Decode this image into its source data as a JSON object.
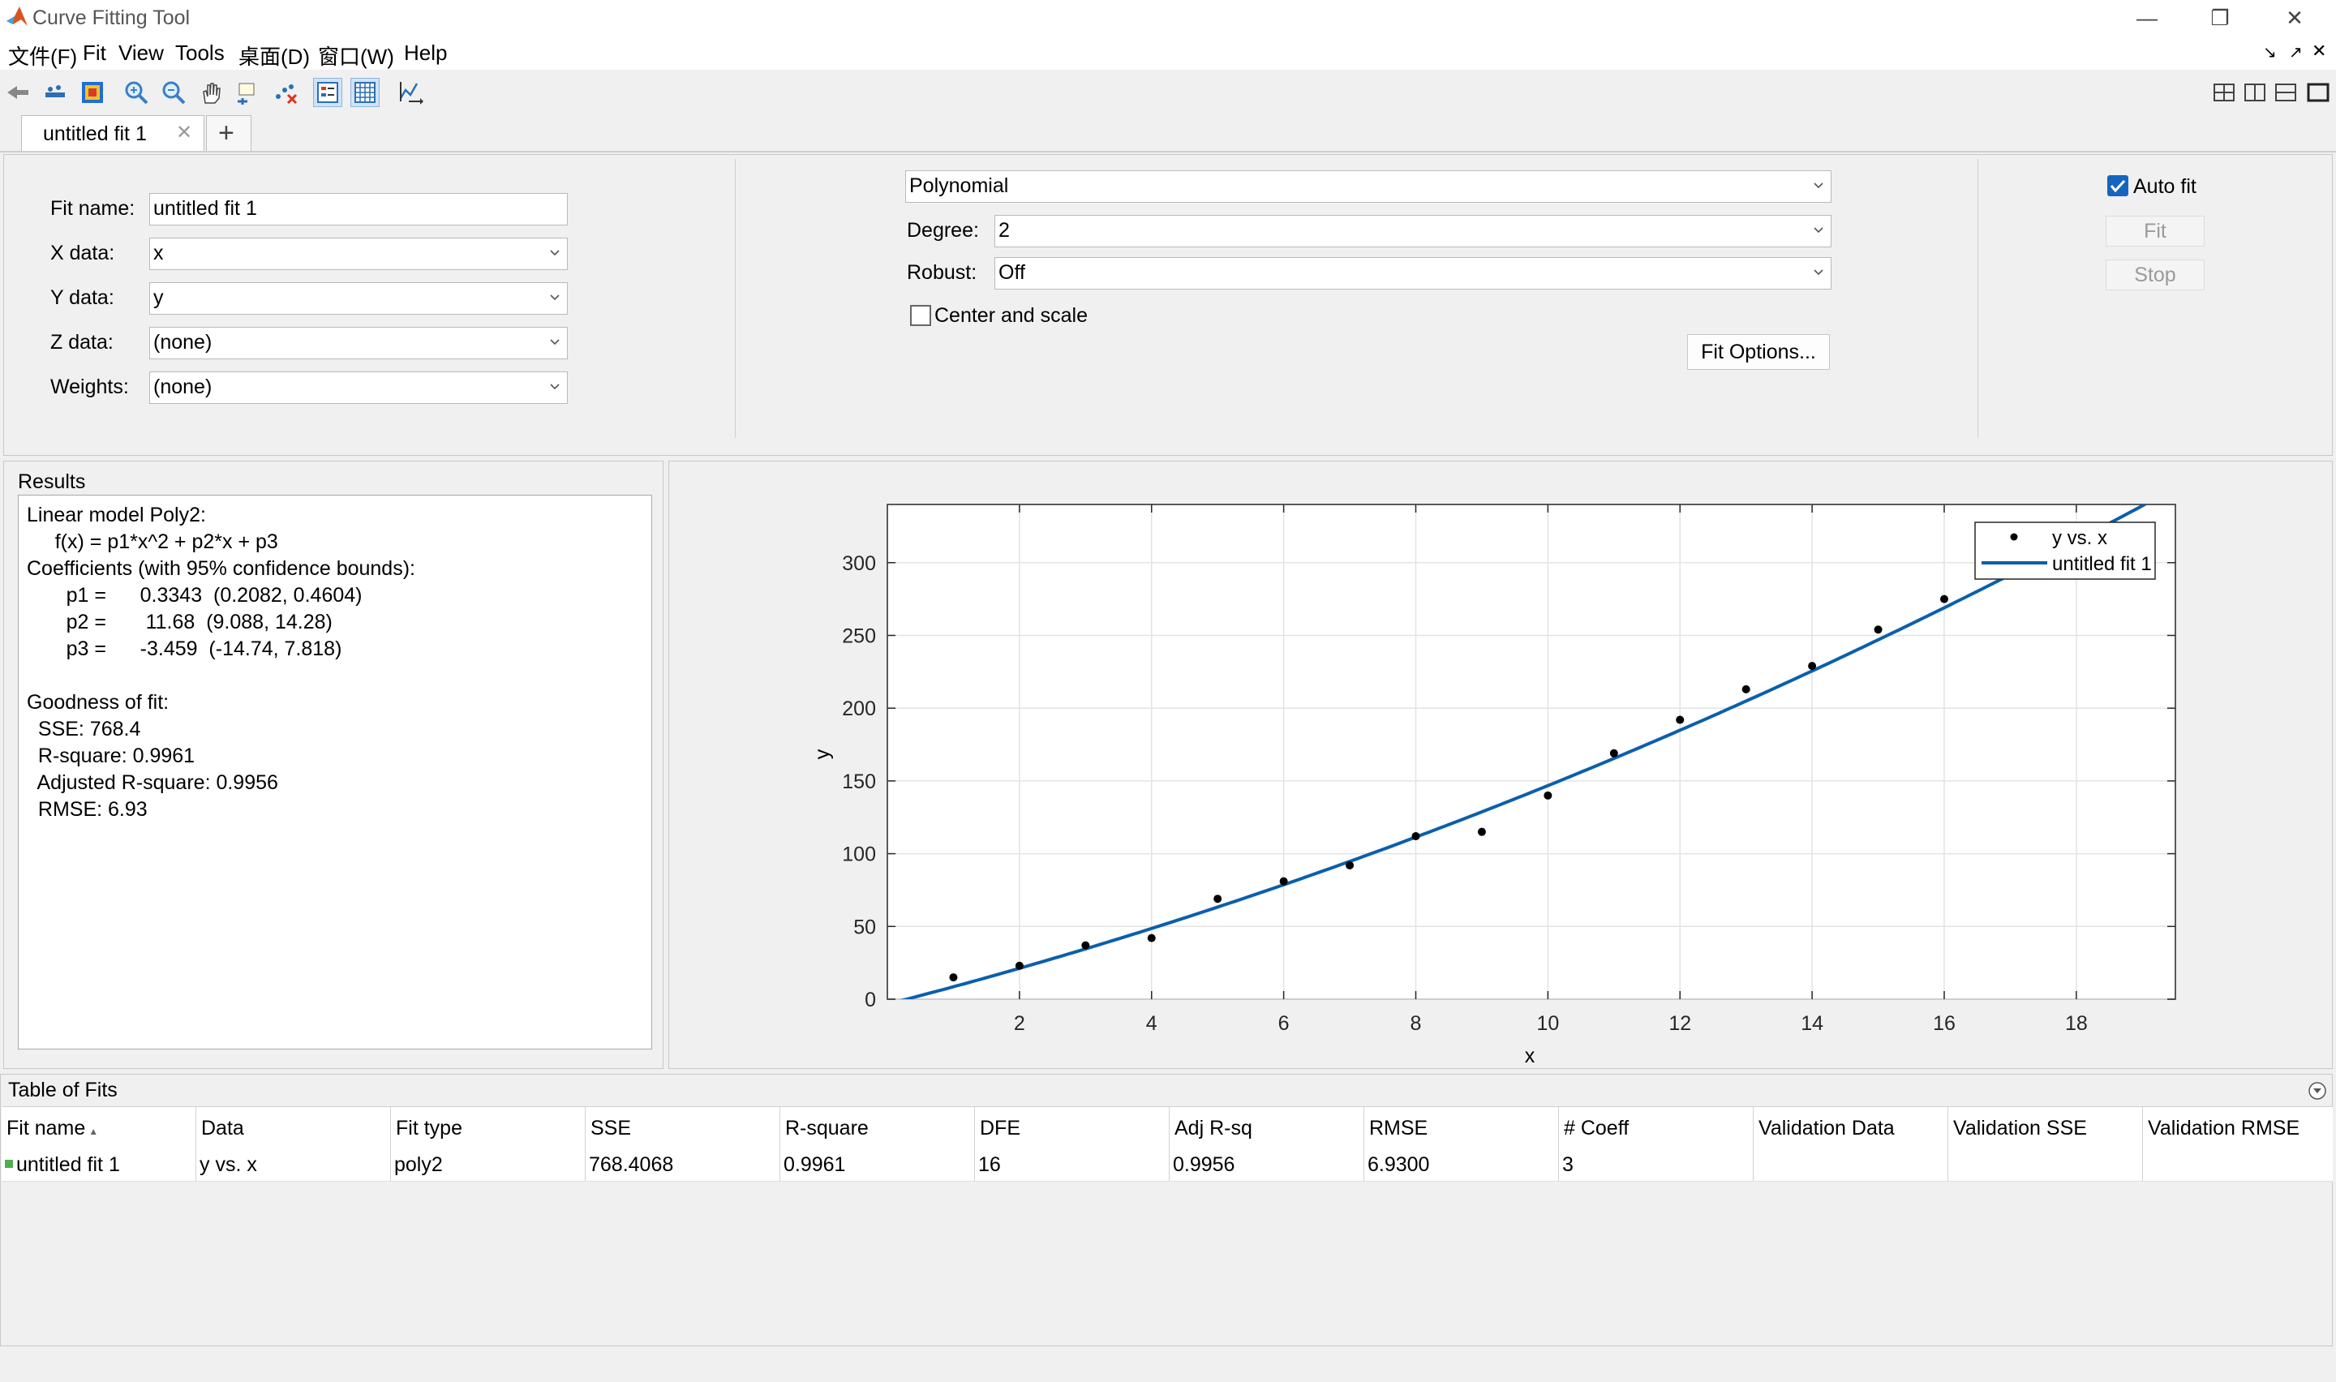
{
  "window": {
    "title": "Curve Fitting Tool"
  },
  "menu": {
    "items": [
      "文件(F)",
      "Fit",
      "View",
      "Tools",
      "桌面(D)",
      "窗口(W)",
      "Help"
    ]
  },
  "tabs": [
    {
      "label": "untitled fit 1"
    }
  ],
  "fit_setup": {
    "fit_name_label": "Fit name:",
    "fit_name_value": "untitled fit 1",
    "x_data_label": "X data:",
    "x_data_value": "x",
    "y_data_label": "Y data:",
    "y_data_value": "y",
    "z_data_label": "Z data:",
    "z_data_value": "(none)",
    "weights_label": "Weights:",
    "weights_value": "(none)"
  },
  "fit_type": {
    "model": "Polynomial",
    "degree_label": "Degree:",
    "degree_value": "2",
    "robust_label": "Robust:",
    "robust_value": "Off",
    "center_scale_label": "Center and scale",
    "center_scale_checked": false,
    "fit_options_label": "Fit Options..."
  },
  "fit_controls": {
    "auto_fit_label": "Auto fit",
    "auto_fit_checked": true,
    "fit_label": "Fit",
    "stop_label": "Stop"
  },
  "results": {
    "title": "Results",
    "lines": [
      "Linear model Poly2:",
      "     f(x) = p1*x^2 + p2*x + p3",
      "Coefficients (with 95% confidence bounds):",
      "       p1 =      0.3343  (0.2082, 0.4604)",
      "       p2 =       11.68  (9.088, 14.28)",
      "       p3 =      -3.459  (-14.74, 7.818)",
      "",
      "Goodness of fit:",
      "  SSE: 768.4",
      "  R-square: 0.9961",
      "  Adjusted R-square: 0.9956",
      "  RMSE: 6.93"
    ]
  },
  "chart_data": {
    "type": "scatter",
    "xlabel": "x",
    "ylabel": "y",
    "xlim": [
      0,
      19.5
    ],
    "ylim": [
      0,
      340
    ],
    "xticks": [
      2,
      4,
      6,
      8,
      10,
      12,
      14,
      16,
      18
    ],
    "yticks": [
      0,
      50,
      100,
      150,
      200,
      250,
      300
    ],
    "grid": true,
    "legend_position": "top-right",
    "series": [
      {
        "name": "y vs. x",
        "kind": "points",
        "color": "#000000",
        "x": [
          1,
          2,
          3,
          4,
          5,
          6,
          7,
          8,
          9,
          10,
          11,
          12,
          13,
          14,
          15,
          16
        ],
        "y": [
          15,
          23,
          37,
          42,
          69,
          81,
          92,
          112,
          115,
          140,
          169,
          192,
          213,
          229,
          254,
          275
        ]
      },
      {
        "name": "untitled fit 1",
        "kind": "curve",
        "color": "#0b5fac",
        "coefficients": {
          "p1": 0.3343,
          "p2": 11.68,
          "p3": -3.459
        }
      }
    ]
  },
  "table_of_fits": {
    "title": "Table of Fits",
    "columns": [
      "Fit name",
      "Data",
      "Fit type",
      "SSE",
      "R-square",
      "DFE",
      "Adj R-sq",
      "RMSE",
      "# Coeff",
      "Validation Data",
      "Validation SSE",
      "Validation RMSE"
    ],
    "rows": [
      [
        "untitled fit 1",
        "y vs. x",
        "poly2",
        "768.4068",
        "0.9961",
        "16",
        "0.9956",
        "6.9300",
        "3",
        "",
        "",
        ""
      ]
    ]
  },
  "colors": {
    "accent": "#0b5fac",
    "fit_indicator": "#4caf50",
    "checkbox": "#1565c0"
  }
}
